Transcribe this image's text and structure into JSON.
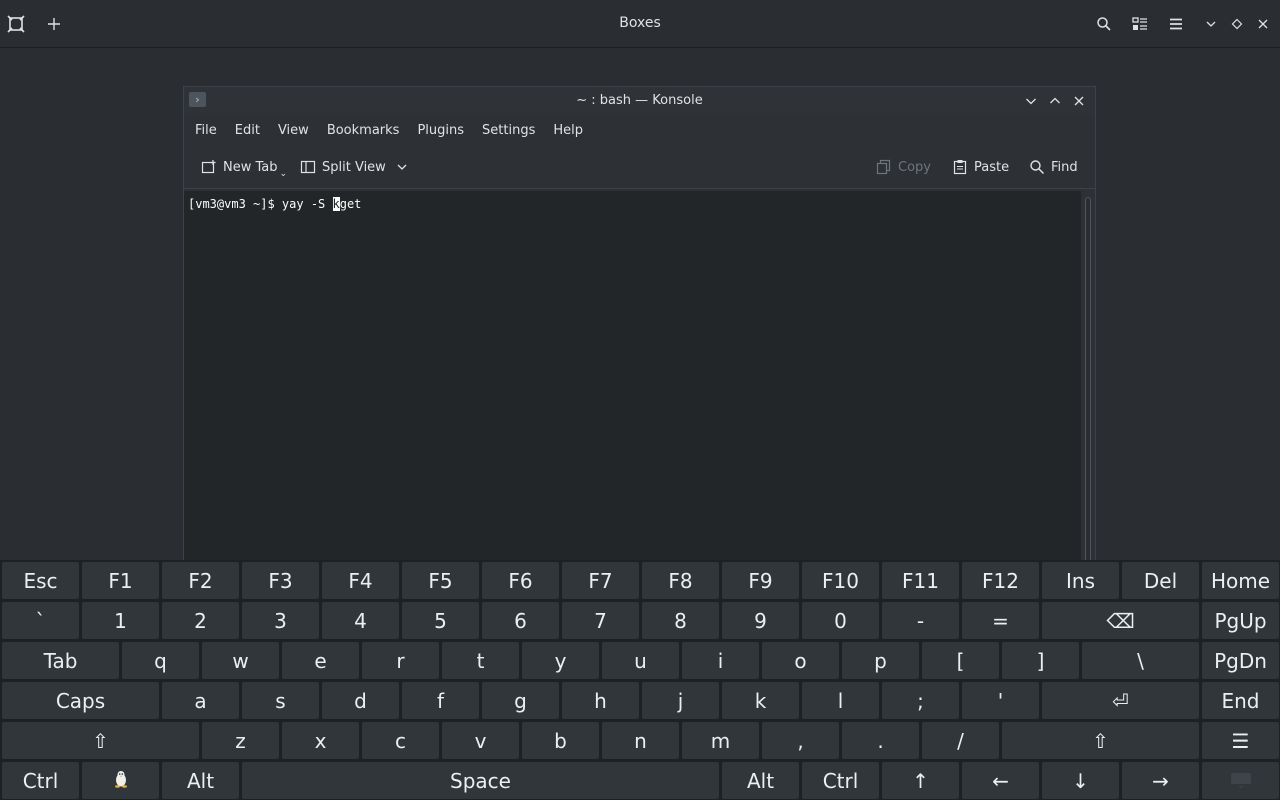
{
  "boxes": {
    "title": "Boxes",
    "icons": [
      "boxes-logo-icon",
      "add-icon",
      "search-icon",
      "view-toggle-icon",
      "hamburger-menu-icon",
      "minimize-icon",
      "maximize-icon",
      "close-icon"
    ]
  },
  "konsole": {
    "title": "~ : bash — Konsole",
    "menu": [
      "File",
      "Edit",
      "View",
      "Bookmarks",
      "Plugins",
      "Settings",
      "Help"
    ],
    "toolbar": {
      "new_tab": "New Tab",
      "split_view": "Split View",
      "copy": "Copy",
      "paste": "Paste",
      "find": "Find"
    },
    "terminal": {
      "prompt": "[vm3@vm3 ~]$ yay -S ",
      "cursor_char": "k",
      "after_cursor": "get"
    }
  },
  "keyboard": {
    "rows": [
      [
        {
          "label": "Esc"
        },
        {
          "label": "F1"
        },
        {
          "label": "F2"
        },
        {
          "label": "F3"
        },
        {
          "label": "F4"
        },
        {
          "label": "F5"
        },
        {
          "label": "F6"
        },
        {
          "label": "F7"
        },
        {
          "label": "F8"
        },
        {
          "label": "F9"
        },
        {
          "label": "F10"
        },
        {
          "label": "F11"
        },
        {
          "label": "F12"
        },
        {
          "label": "Ins"
        },
        {
          "label": "Del"
        },
        {
          "label": "Home"
        }
      ],
      [
        {
          "label": "`"
        },
        {
          "label": "1"
        },
        {
          "label": "2"
        },
        {
          "label": "3"
        },
        {
          "label": "4"
        },
        {
          "label": "5"
        },
        {
          "label": "6"
        },
        {
          "label": "7"
        },
        {
          "label": "8"
        },
        {
          "label": "9"
        },
        {
          "label": "0"
        },
        {
          "label": "-"
        },
        {
          "label": "="
        },
        {
          "label": "⌫"
        },
        {
          "label": "PgUp"
        }
      ],
      [
        {
          "label": "Tab"
        },
        {
          "label": "q"
        },
        {
          "label": "w"
        },
        {
          "label": "e"
        },
        {
          "label": "r"
        },
        {
          "label": "t"
        },
        {
          "label": "y"
        },
        {
          "label": "u"
        },
        {
          "label": "i"
        },
        {
          "label": "o"
        },
        {
          "label": "p"
        },
        {
          "label": "["
        },
        {
          "label": "]"
        },
        {
          "label": "\\"
        },
        {
          "label": "PgDn"
        }
      ],
      [
        {
          "label": "Caps"
        },
        {
          "label": "a"
        },
        {
          "label": "s"
        },
        {
          "label": "d"
        },
        {
          "label": "f"
        },
        {
          "label": "g"
        },
        {
          "label": "h"
        },
        {
          "label": "j"
        },
        {
          "label": "k"
        },
        {
          "label": "l"
        },
        {
          "label": ";"
        },
        {
          "label": "'"
        },
        {
          "label": "⏎"
        },
        {
          "label": "End"
        }
      ],
      [
        {
          "label": "⇧"
        },
        {
          "label": "z"
        },
        {
          "label": "x"
        },
        {
          "label": "c"
        },
        {
          "label": "v"
        },
        {
          "label": "b"
        },
        {
          "label": "n"
        },
        {
          "label": "m"
        },
        {
          "label": ","
        },
        {
          "label": "."
        },
        {
          "label": "/"
        },
        {
          "label": "⇧"
        },
        {
          "label": "☰"
        }
      ],
      [
        {
          "label": "Ctrl"
        },
        {
          "label": "",
          "icon": "tux-icon"
        },
        {
          "label": "Alt"
        },
        {
          "label": "Space"
        },
        {
          "label": "Alt"
        },
        {
          "label": "Ctrl"
        },
        {
          "label": "↑"
        },
        {
          "label": "←"
        },
        {
          "label": "↓"
        },
        {
          "label": "→"
        },
        {
          "label": "",
          "icon": "keyboard-hide-icon"
        }
      ]
    ]
  }
}
